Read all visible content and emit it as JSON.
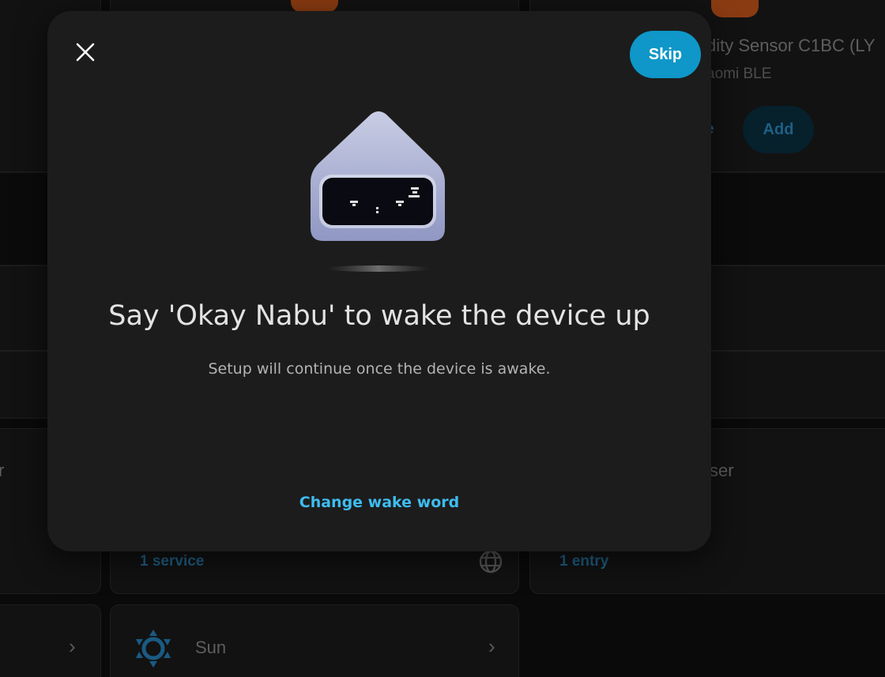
{
  "background": {
    "card_top_right_title": "dity Sensor C1BC (LY",
    "card_top_right_subtitle": "aomi BLE",
    "card_top_right_partial_button": "e",
    "card_top_right_add": "Add",
    "row_left_partial": "r",
    "row_right_partial": "ser",
    "services_link": "1 service",
    "entry_link": "1 entry",
    "sun_label": "Sun"
  },
  "dialog": {
    "close_icon": "close-icon",
    "skip_label": "Skip",
    "title": "Say 'Okay Nabu' to wake the device up",
    "subtitle": "Setup will continue once the device is awake.",
    "change_wake_word_label": "Change wake word"
  },
  "colors": {
    "accent": "#0e97c8",
    "link": "#3ebcf0",
    "dialog_bg": "#1c1c1c"
  }
}
